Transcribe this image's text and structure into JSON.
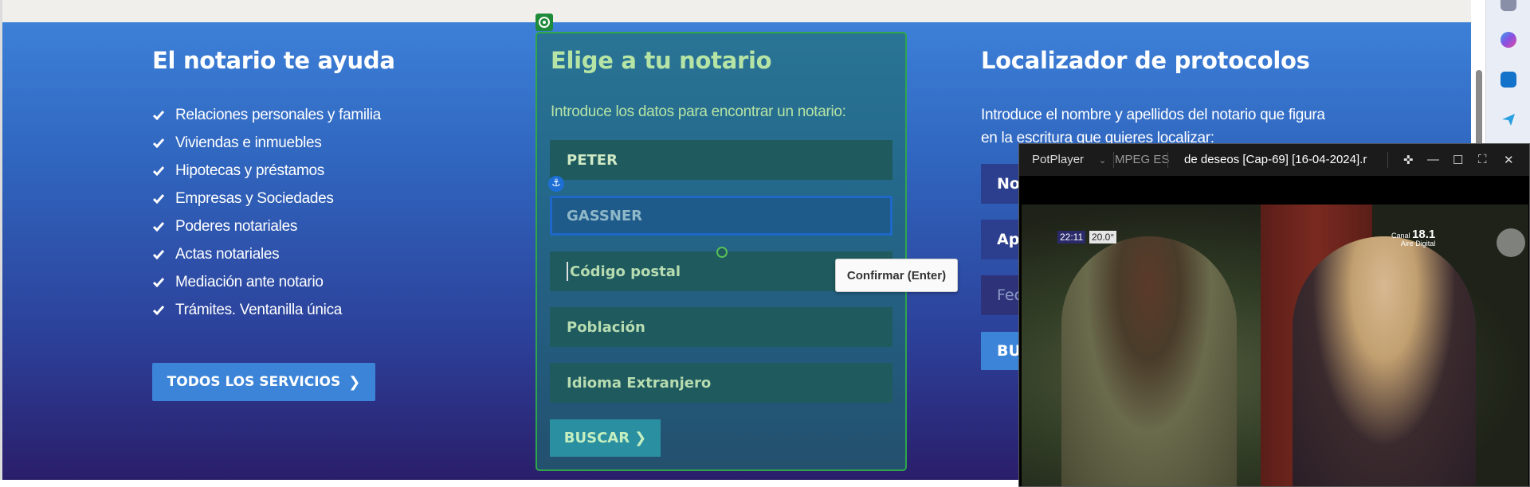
{
  "left": {
    "title": "El notario te ayuda",
    "items": [
      "Relaciones personales y familia",
      "Viviendas e inmuebles",
      "Hipotecas y préstamos",
      "Empresas y Sociedades",
      "Poderes notariales",
      "Actas notariales",
      "Mediación ante notario",
      "Trámites. Ventanilla única"
    ],
    "button": "TODOS LOS SERVICIOS"
  },
  "middle": {
    "title": "Elige a tu notario",
    "subtitle": "Introduce los datos para encontrar un notario:",
    "fields": {
      "nombre_value": "PETER",
      "apellidos_value": "GASSNER",
      "codigo_postal_placeholder": "Código postal",
      "poblacion_placeholder": "Población",
      "idioma_placeholder": "Idioma Extranjero"
    },
    "button": "BUSCAR",
    "tooltip": "Confirmar (Enter)"
  },
  "right": {
    "title": "Localizador de protocolos",
    "text_line1": "Introduce el nombre y apellidos del notario que figura",
    "text_line2": "en la escritura que quieres localizar:",
    "field1": "No",
    "field2": "Ap",
    "field3": "Fec",
    "button": "BU"
  },
  "player": {
    "app": "PotPlayer",
    "codec": "MPEG ES",
    "title": "de deseos [Cap-69] [16-04-2024].r",
    "hud_time": "22:11",
    "hud_temp": "20.0°",
    "channel_label": "Canal",
    "channel_number": "18.1",
    "channel_sub": "Aire Digital"
  },
  "colors": {
    "accent_green": "#b5e4a4",
    "button_blue": "#3c84d8",
    "panel_border": "#2fa64a"
  }
}
